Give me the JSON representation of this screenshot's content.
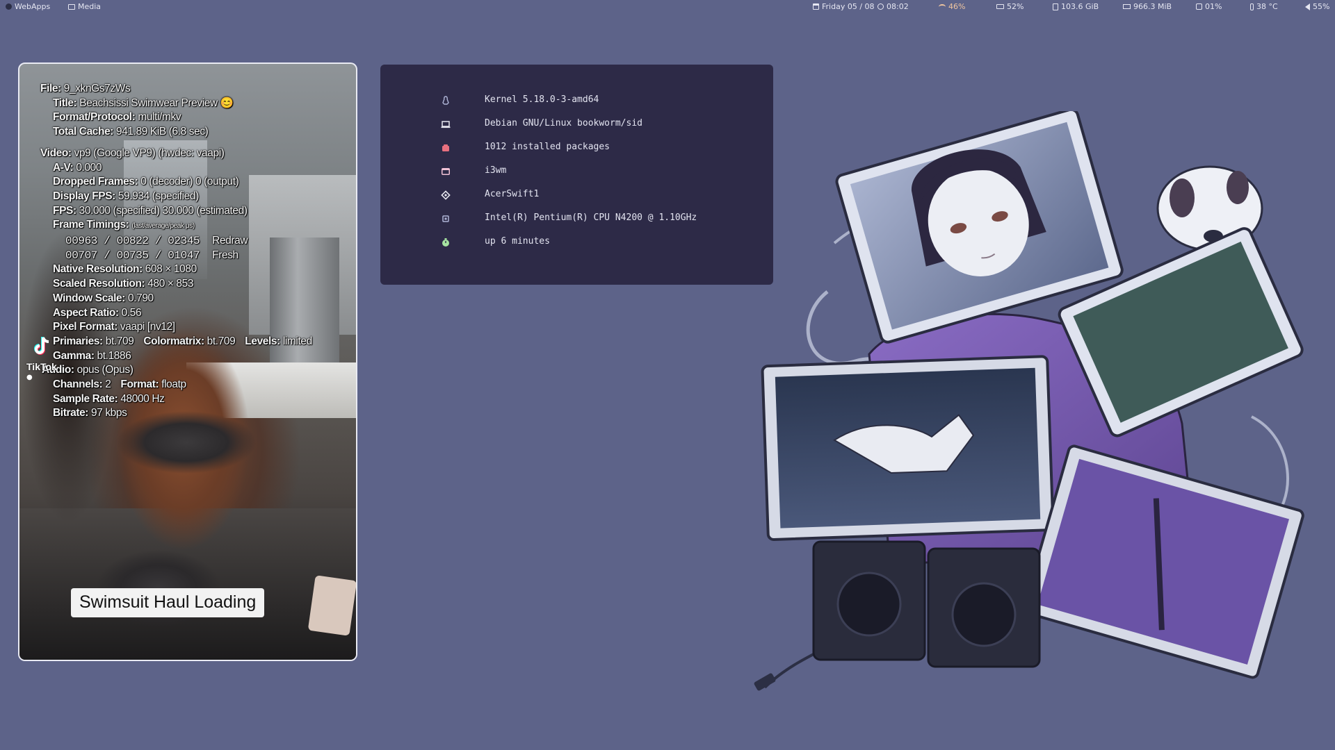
{
  "topbar": {
    "left": [
      {
        "label": "WebApps",
        "icon": "app-icon"
      },
      {
        "label": "Media",
        "icon": "media-icon"
      }
    ],
    "date": "Friday 05 / 08",
    "time": "08:02",
    "wifi": "46%",
    "battery": "52%",
    "disk": "103.6 GiB",
    "memory": "966.3 MiB",
    "cpu": "01%",
    "temperature": "38 °C",
    "volume": "55%",
    "accent_color": "#f0c6a0"
  },
  "video": {
    "osd": {
      "file": {
        "label": "File:",
        "value": "9_xknGs7zWs"
      },
      "title": {
        "label": "Title:",
        "value": "Beachsissi Swimwear Preview 😊"
      },
      "format": {
        "label": "Format/Protocol:",
        "value": "multi/mkv"
      },
      "cache": {
        "label": "Total Cache:",
        "value": "941.89 KiB  (6.8 sec)"
      },
      "video": {
        "label": "Video:",
        "value": "vp9 (Google VP9) (hwdec: vaapi)"
      },
      "av": {
        "label": "A-V:",
        "value": "0.000"
      },
      "dropped": {
        "label": "Dropped Frames:",
        "value": "0 (decoder)  0 (output)"
      },
      "display_fps": {
        "label": "Display FPS:",
        "value": "59.934 (specified)"
      },
      "fps": {
        "label": "FPS:",
        "value": "30.000 (specified)  30.000 (estimated)"
      },
      "frame_timings": {
        "label": "Frame Timings:",
        "note": "(last/average/peak μs)"
      },
      "timing_redraw": {
        "values": "00963  /  00822  /  02345",
        "label": "Redraw"
      },
      "timing_fresh": {
        "values": "00707  /  00735  /  01047",
        "label": "Fresh"
      },
      "native_res": {
        "label": "Native Resolution:",
        "value": "608 × 1080"
      },
      "scaled_res": {
        "label": "Scaled Resolution:",
        "value": "480 × 853"
      },
      "window_scale": {
        "label": "Window Scale:",
        "value": "0.790"
      },
      "aspect": {
        "label": "Aspect Ratio:",
        "value": "0.56"
      },
      "pixel_format": {
        "label": "Pixel Format:",
        "value": "vaapi [nv12]"
      },
      "primaries": {
        "label": "Primaries:",
        "value": "bt.709"
      },
      "colormatrix": {
        "label": "Colormatrix:",
        "value": "bt.709"
      },
      "levels": {
        "label": "Levels:",
        "value": "limited"
      },
      "gamma": {
        "label": "Gamma:",
        "value": "bt.1886"
      },
      "audio": {
        "label": "Audio:",
        "value": "opus (Opus)"
      },
      "channels": {
        "label": "Channels:",
        "value": "2"
      },
      "afmt": {
        "label": "Format:",
        "value": "floatp"
      },
      "sample_rate": {
        "label": "Sample Rate:",
        "value": "48000 Hz"
      },
      "bitrate": {
        "label": "Bitrate:",
        "value": "97 kbps"
      }
    },
    "watermark": "TikTok",
    "caption": "Swimsuit Haul Loading"
  },
  "sysinfo": {
    "rows": [
      {
        "icon": "linux-icon",
        "color": "#aeb4d6",
        "text": "Kernel 5.18.0-3-amd64"
      },
      {
        "icon": "laptop-icon",
        "color": "#e8e8f0",
        "text": "Debian GNU/Linux bookworm/sid"
      },
      {
        "icon": "package-icon",
        "color": "#e8707f",
        "text": "1012 installed packages"
      },
      {
        "icon": "window-icon",
        "color": "#f1c2d6",
        "text": "i3wm"
      },
      {
        "icon": "host-icon",
        "color": "#e8e8f0",
        "text": "AcerSwift1"
      },
      {
        "icon": "cpu-icon",
        "color": "#aeb4d6",
        "text": "Intel(R) Pentium(R) CPU N4200 @ 1.10GHz"
      },
      {
        "icon": "uptime-icon",
        "color": "#a6e3a1",
        "text": "up 6 minutes"
      }
    ]
  }
}
